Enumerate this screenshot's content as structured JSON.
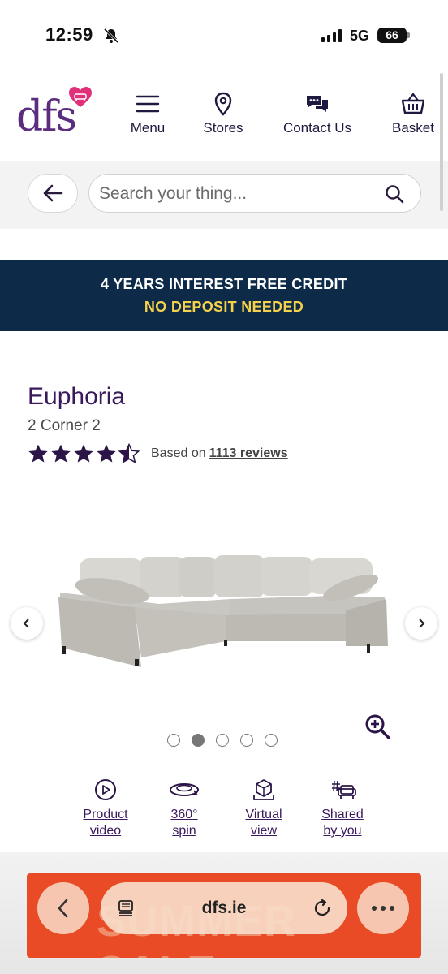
{
  "status_bar": {
    "time": "12:59",
    "network": "5G",
    "battery": "66"
  },
  "header": {
    "logo_text": "dfs",
    "nav": [
      {
        "label": "Menu",
        "icon": "hamburger-icon"
      },
      {
        "label": "Stores",
        "icon": "location-pin-icon"
      },
      {
        "label": "Contact Us",
        "icon": "chat-bubbles-icon"
      },
      {
        "label": "Basket",
        "icon": "basket-icon"
      }
    ]
  },
  "search": {
    "placeholder": "Search your thing..."
  },
  "promo": {
    "line1": "4 YEARS INTEREST FREE CREDIT",
    "line2": "NO DEPOSIT NEEDED"
  },
  "product": {
    "name": "Euphoria",
    "variant": "2 Corner 2",
    "rating": 4.5,
    "reviews_prefix": "Based on",
    "reviews_link": "1113 reviews"
  },
  "gallery": {
    "image_count": 5,
    "active_index": 1
  },
  "media_options": [
    {
      "line1": "Product",
      "line2": "video",
      "icon": "play-circle-icon"
    },
    {
      "line1": "360°",
      "line2": "spin",
      "icon": "rotate-360-icon"
    },
    {
      "line1": "Virtual",
      "line2": "view",
      "icon": "ar-cube-icon"
    },
    {
      "line1": "Shared",
      "line2": "by you",
      "icon": "hashtag-sofa-icon"
    }
  ],
  "browser": {
    "url": "dfs.ie",
    "banner_text": "SUMMER SALE"
  },
  "colors": {
    "brand_purple": "#5c2d7e",
    "navy": "#0d2a48",
    "promo_yellow": "#f5d24a",
    "sale_orange": "#e84b25"
  }
}
